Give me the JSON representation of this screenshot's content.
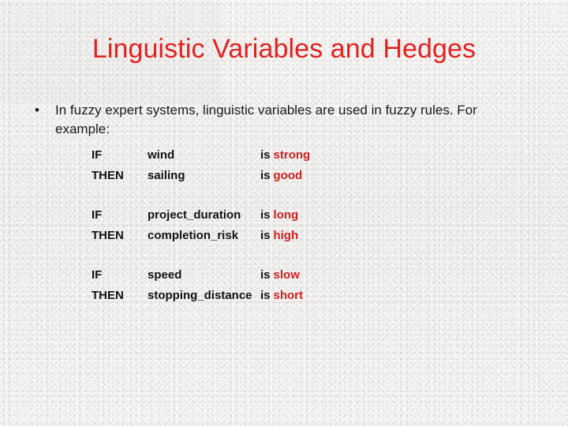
{
  "slide": {
    "title": "Linguistic Variables and Hedges",
    "title_color": "#e22222",
    "background_color": "#f1f0ee",
    "body_text_color": "#1a1a1a",
    "hedge_color": "#cc2222"
  },
  "bullet": {
    "marker": "•",
    "text": "In fuzzy expert systems, linguistic variables are used in fuzzy rules.  For example:"
  },
  "rules": {
    "keyword_if": "IF",
    "keyword_then": "THEN",
    "predicate_word": "is",
    "groups": [
      {
        "antecedent": {
          "keyword": "IF",
          "variable": "wind",
          "is": "is",
          "hedge": "strong"
        },
        "consequent": {
          "keyword": "THEN",
          "variable": "sailing",
          "is": "is",
          "hedge": "good"
        }
      },
      {
        "antecedent": {
          "keyword": "IF",
          "variable": "project_duration",
          "is": "is",
          "hedge": "long"
        },
        "consequent": {
          "keyword": "THEN",
          "variable": "completion_risk",
          "is": "is",
          "hedge": "high"
        }
      },
      {
        "antecedent": {
          "keyword": "IF",
          "variable": "speed",
          "is": "is",
          "hedge": "slow"
        },
        "consequent": {
          "keyword": "THEN",
          "variable": "stopping_distance",
          "is": "is",
          "hedge": "short"
        }
      }
    ]
  }
}
